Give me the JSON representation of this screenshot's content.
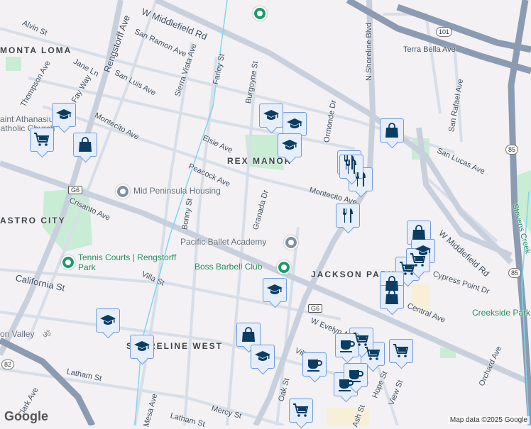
{
  "colors": {
    "marker_bg": "#e6edfb",
    "marker_border": "#6f9ae0",
    "icon": "#0b3d63",
    "park": "#c8ecd4",
    "road": "#d3dbe6",
    "highway": "#8a9bb2"
  },
  "areas": [
    "MONTA LOMA",
    "REX MANOR",
    "JACKSON PARK",
    "SHORELINE WEST",
    "ASTRO CITY"
  ],
  "streets": [
    "Alvin St",
    "W Middlefield Rd",
    "San Ramon Ave",
    "Rengstorff Ave",
    "Jane Ln",
    "San Luis Ave",
    "Sierra Vista Ave",
    "Farley St",
    "Burgoyne St",
    "Thompson Ave",
    "Fay Way",
    "Montecito Ave",
    "Elsie Ave",
    "Peacock Ave",
    "Crisanto Ave",
    "Bonny St",
    "Granada Dr",
    "Villa St",
    "California St",
    "Latham St",
    "Clark Ave",
    "Mercy St",
    "Oak St",
    "W Evelyn Ave",
    "Hope St",
    "View St",
    "Central Ave",
    "Cypress Point Dr",
    "Orchard Ave",
    "W Middlefield Rd",
    "Terra Bella Ave",
    "San Rafael Ave",
    "San Lucas Ave",
    "N Shoreline Blvd",
    "Ormonde Dr",
    "Stevens Creek",
    "Montecito Ave",
    "Villa St",
    "Ash St",
    "Latham St",
    "Mesa Ave"
  ],
  "pois": {
    "housing": "Mid Peninsula Housing",
    "ballet": "Pacific Ballet Academy",
    "barbell": "Boss Barbell Club",
    "tennis": "Tennis Courts | Rengstorff Park",
    "church": "Saint Athanasius Catholic Church",
    "creekside": "Creekside Park",
    "valley": "on Valley"
  },
  "shields": [
    "G6",
    "G6",
    "101",
    "85",
    "85",
    "82"
  ],
  "markers": [
    "school",
    "shopping-cart",
    "shopping-bag",
    "school",
    "school",
    "school",
    "restaurant",
    "restaurant",
    "restaurant",
    "shopping-bag",
    "restaurant",
    "shopping-bag",
    "school",
    "shopping-cart",
    "shopping-cart",
    "shopping-bag",
    "shopping-bag",
    "school",
    "school",
    "school",
    "shopping-bag",
    "school",
    "coffee",
    "shopping-cart",
    "shopping-cart",
    "shopping-cart",
    "coffee",
    "coffee",
    "coffee",
    "shopping-cart"
  ],
  "attribution": "Map data ©2025 Google",
  "logo": "Google"
}
